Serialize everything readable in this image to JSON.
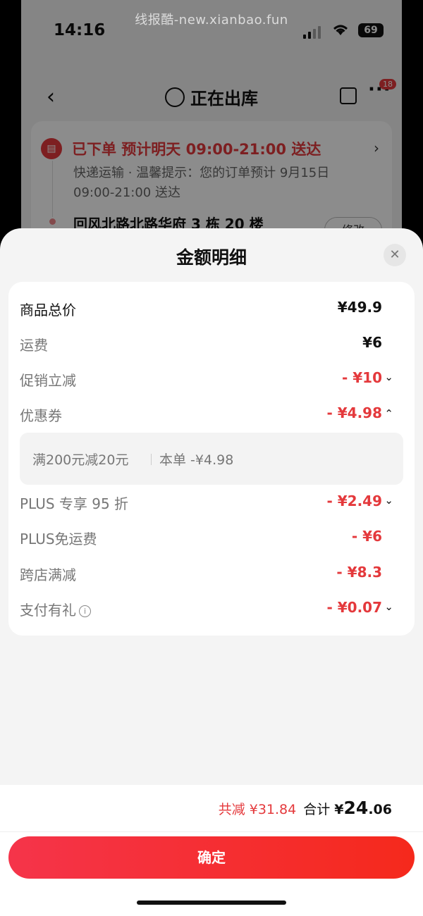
{
  "watermark": "线报酷-new.xianbao.fun",
  "status_bar": {
    "time": "14:16",
    "battery": "69"
  },
  "nav": {
    "title": "正在出库",
    "back_icon": "chevron-left-icon",
    "badge": "18"
  },
  "order": {
    "status": "已下单  预计明天 09:00-21:00 送达",
    "tip": "快递运输 · 温馨提示：您的订单预计 9月15日 09:00-21:00 送达",
    "address": "回风北路北路华府 3 栋 20 楼",
    "modify_label": "修改"
  },
  "sheet": {
    "title": "金额明细",
    "close_icon": "close-icon",
    "rows": [
      {
        "label": "商品总价",
        "value": "¥49.9"
      },
      {
        "label": "运费",
        "value": "¥6"
      },
      {
        "label": "促销立减",
        "value": "- ¥10"
      },
      {
        "label": "优惠券",
        "value": "- ¥4.98"
      },
      {
        "label": "PLUS 专享 95 折",
        "value": "- ¥2.49"
      },
      {
        "label": "PLUS免运费",
        "value": "- ¥6"
      },
      {
        "label": "跨店满减",
        "value": "- ¥8.3"
      },
      {
        "label": "支付有礼",
        "value": "- ¥0.07"
      }
    ],
    "coupon": {
      "desc": "满200元减20元",
      "amount": "本单 -¥4.98"
    }
  },
  "footer": {
    "savings": "共减 ¥31.84",
    "total_label": "合计",
    "total_symbol": "¥",
    "total_int": "24",
    "total_dec": ".06",
    "confirm_label": "确定"
  },
  "colors": {
    "accent": "#e4393c",
    "button_start": "#f5344a",
    "button_end": "#f5291c"
  }
}
